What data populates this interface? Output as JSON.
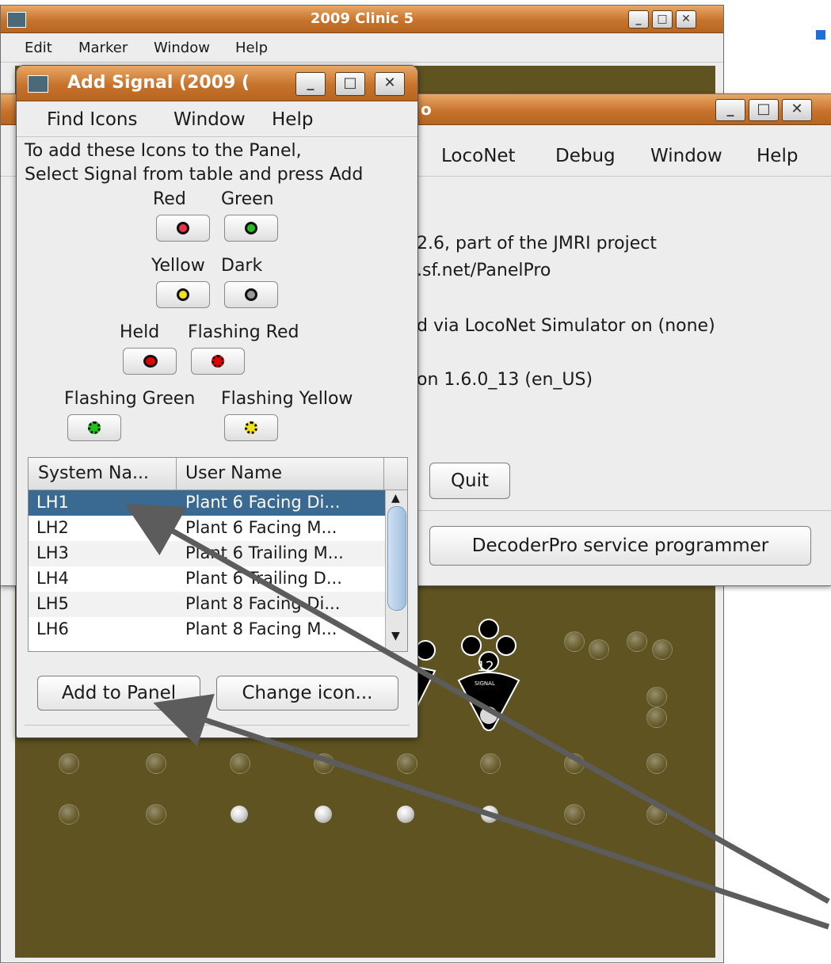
{
  "main_window": {
    "title": "2009 Clinic 5",
    "menu": [
      "Edit",
      "Marker",
      "Window",
      "Help"
    ]
  },
  "panelpro_window": {
    "title_fragment": "o",
    "menu": [
      "LocoNet",
      "Debug",
      "Window",
      "Help"
    ],
    "info_lines": [
      "2.6, part of the JMRI project",
      ".sf.net/PanelPro",
      "d via LocoNet Simulator on (none)",
      "on 1.6.0_13 (en_US)"
    ],
    "quit_label": "Quit",
    "decoderpro_label": "DecoderPro service programmer"
  },
  "add_signal_window": {
    "title": "Add Signal (2009 (",
    "menu": [
      "Find Icons",
      "Window",
      "Help"
    ],
    "instructions": [
      "To add these Icons to the Panel,",
      "Select Signal from table and press Add"
    ],
    "icons": [
      {
        "label": "Red",
        "color": "#e8344a"
      },
      {
        "label": "Green",
        "color": "#22c11d"
      },
      {
        "label": "Yellow",
        "color": "#f0e21a"
      },
      {
        "label": "Dark",
        "color": "#7a7a7a"
      },
      {
        "label": "Held",
        "color": "#e00000"
      },
      {
        "label": "Flashing Red",
        "color": "#e00000"
      },
      {
        "label": "Flashing Green",
        "color": "#22c11d"
      },
      {
        "label": "Flashing Yellow",
        "color": "#f0e21a"
      }
    ],
    "table": {
      "columns": [
        "System Na...",
        "User Name"
      ],
      "rows": [
        {
          "system": "LH1",
          "user": "Plant 6 Facing Di..."
        },
        {
          "system": "LH2",
          "user": "Plant 6 Facing M..."
        },
        {
          "system": "LH3",
          "user": "Plant 6 Trailing M..."
        },
        {
          "system": "LH4",
          "user": "Plant 6 Trailing D..."
        },
        {
          "system": "LH5",
          "user": "Plant 8 Facing Di..."
        },
        {
          "system": "LH6",
          "user": "Plant 8 Facing M..."
        }
      ]
    },
    "add_button": "Add to Panel",
    "change_button": "Change icon..."
  },
  "panel_signal_label": "12",
  "panel_signal_caption": "SIGNAL",
  "colors": {
    "title_orange": "#c7732c",
    "panel_olive": "#5f5421",
    "selection_blue": "#3a6a92",
    "arrow_gray": "#5c5c5c",
    "accent_blue": "#1f6fd6"
  }
}
